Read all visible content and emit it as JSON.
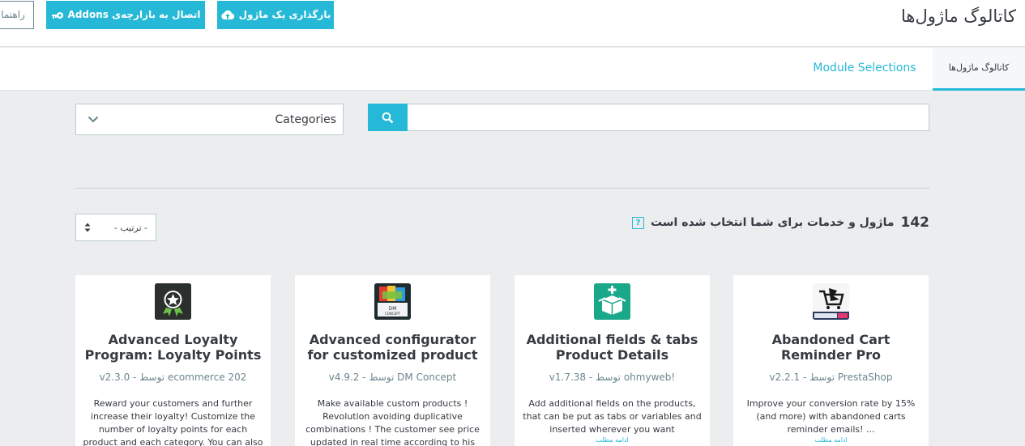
{
  "header": {
    "title": "کاتالوگ ماژول‌ها",
    "help_label": "راهنما",
    "addons_label": "اتصال به بازارچه‌ی Addons",
    "upload_label": "بارگذاری یک ماژول"
  },
  "tabs": [
    {
      "label": "کاتالوگ ماژول‌ها",
      "active": true
    },
    {
      "label": "Module Selections",
      "active": false
    }
  ],
  "filters": {
    "categories_label": "Categories",
    "search_placeholder": "",
    "sort_label": "- ترتیب -"
  },
  "summary": {
    "count": "142",
    "text": "ماژول و خدمات برای شما انتخاب شده است",
    "help": "?"
  },
  "modules": [
    {
      "icon": "loyalty-star-icon",
      "title": "Advanced Loyalty Program: Loyalty Points",
      "meta": "v2.3.0 - توسط ecommerce 202",
      "desc": "Reward your customers and further increase their loyalty! Customize the number of loyalty points for each product and each category. You can also easily",
      "more": ""
    },
    {
      "icon": "configurator-icon",
      "title": "Advanced configurator for customized product",
      "meta": "v4.9.2 - توسط DM Concept",
      "desc": "Make available custom products ! Revolution avoiding duplicative combinations ! The customer see price updated in real time according to his",
      "more": ""
    },
    {
      "icon": "box-plus-icon",
      "title": "Additional fields & tabs Product Details",
      "meta": "v1.7.38 - توسط ohmyweb!",
      "desc": "Add additional fields on the products, that can be put as tabs or variables and inserted wherever you want",
      "more": "ادامه مطلب"
    },
    {
      "icon": "abandoned-cart-icon",
      "title": "Abandoned Cart Reminder Pro",
      "meta": "v2.2.1 - توسط PrestaShop",
      "desc": "Improve your conversion rate by 15% (and more) with abandoned carts reminder emails! ...",
      "more": "ادامه مطلب"
    }
  ],
  "colors": {
    "accent": "#25b9d7",
    "background": "#ebedee",
    "text": "#363a41"
  }
}
